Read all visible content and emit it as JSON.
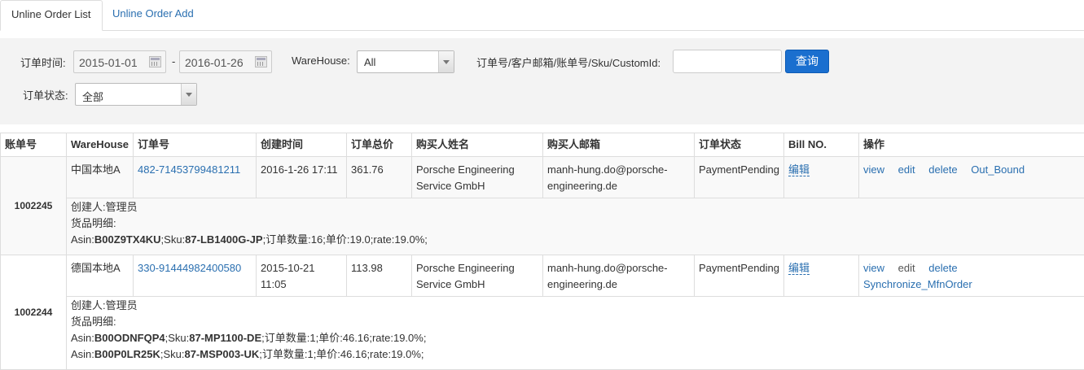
{
  "tabs": [
    {
      "label": "Unline Order List",
      "active": true
    },
    {
      "label": "Unline Order Add",
      "active": false
    }
  ],
  "filters": {
    "order_time_label": "订单时间:",
    "date_from": "2015-01-01",
    "date_sep": "-",
    "date_to": "2016-01-26",
    "warehouse_label": "WareHouse:",
    "warehouse_value": "All",
    "search_label": "订单号/客户邮箱/账单号/Sku/CustomId:",
    "search_value": "",
    "search_button": "查询",
    "status_label": "订单状态:",
    "status_value": "全部"
  },
  "table": {
    "headers": [
      "账单号",
      "WareHouse",
      "订单号",
      "创建时间",
      "订单总价",
      "购买人姓名",
      "购买人邮箱",
      "订单状态",
      "Bill NO.",
      "操作"
    ],
    "orders": [
      {
        "account": "1002245",
        "warehouse": "中国本地A",
        "order_no": "482-71453799481211",
        "created": "2016-1-26 17:11",
        "total": "361.76",
        "buyer_name": "Porsche Engineering Service GmbH",
        "buyer_email": "manh-hung.do@porsche-engineering.de",
        "status": "PaymentPending",
        "bill_no": "编辑",
        "actions": [
          "view",
          "edit",
          "delete",
          "Out_Bound"
        ],
        "creator": "创建人:管理员",
        "goods_label": "货品明细:",
        "items": [
          {
            "asin_label": "Asin:",
            "asin": "B00Z9TX4KU",
            "sku_label": ";Sku:",
            "sku": "87-LB1400G-JP",
            "rest": ";订单数量:16;单价:19.0;rate:19.0%;"
          }
        ]
      },
      {
        "account": "1002244",
        "warehouse": "德国本地A",
        "order_no": "330-91444982400580",
        "created": "2015-10-21 11:05",
        "total": "113.98",
        "buyer_name": "Porsche Engineering Service GmbH",
        "buyer_email": "manh-hung.do@porsche-engineering.de",
        "status": "PaymentPending",
        "bill_no": "编辑",
        "actions": [
          "view",
          "edit",
          "delete",
          "Synchronize_MfnOrder"
        ],
        "creator": "创建人:管理员",
        "goods_label": "货品明细:",
        "items": [
          {
            "asin_label": "Asin:",
            "asin": "B00ODNFQP4",
            "sku_label": ";Sku:",
            "sku": "87-MP1100-DE",
            "rest": ";订单数量:1;单价:46.16;rate:19.0%;"
          },
          {
            "asin_label": "Asin:",
            "asin": "B00P0LR25K",
            "sku_label": ";Sku:",
            "sku": "87-MSP003-UK",
            "rest": ";订单数量:1;单价:46.16;rate:19.0%;"
          }
        ]
      }
    ]
  }
}
